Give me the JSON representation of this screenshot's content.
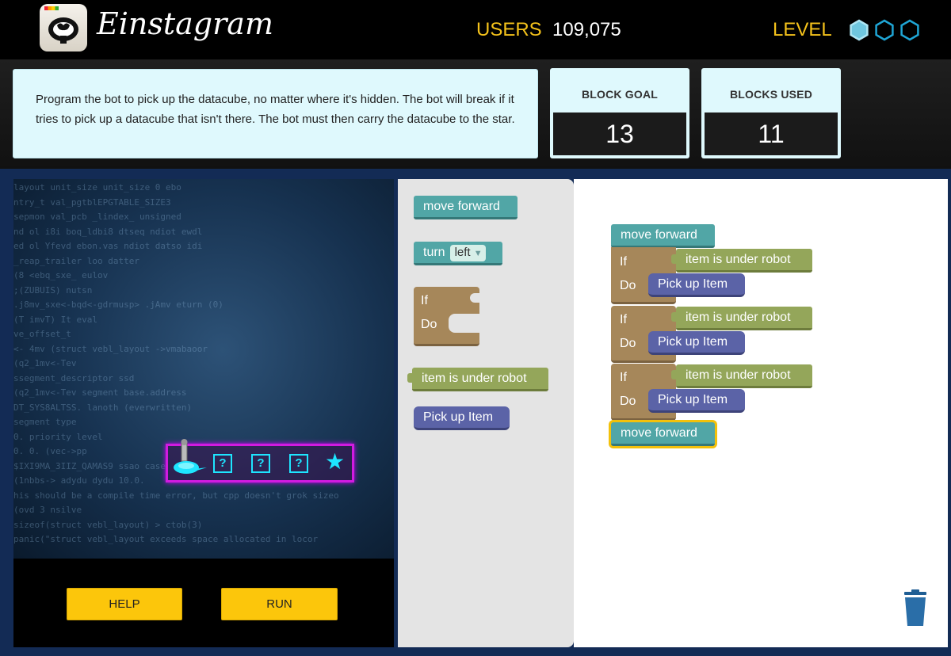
{
  "header": {
    "app_name": "Einstagram",
    "users_label": "USERS",
    "users_value": "109,075",
    "level_label": "LEVEL",
    "level_total": 3,
    "level_completed": 1
  },
  "instructions": {
    "text": "Program the bot to pick up the datacube, no matter where it's hidden. The bot will break if it tries to pick up a datacube that isn't there. The bot must then carry the datacube to the star."
  },
  "stats": {
    "block_goal_label": "BLOCK GOAL",
    "block_goal_value": "13",
    "blocks_used_label": "BLOCKS USED",
    "blocks_used_value": "11"
  },
  "game": {
    "track_cells": [
      "?",
      "?",
      "?"
    ],
    "goal_icon": "star-icon",
    "robot_icon": "robot-icon",
    "background_code": [
      "layout   unit_size   unit_size    0  ebo",
      "ntry_t        val_pgtblEPGTABLE_SIZE3",
      "sepmon val_pcb    _lindex_  unsigned",
      "nd  ol  i8i  boq_ldbi8   dtseq   ndiot   ewdl",
      "ed  ol  Yfevd  ebon.vas  ndiot  datso  idi",
      "         _reap_trailer  loo  datter",
      "         (8  <ebq_sxe_  eulov",
      "         ;(ZUBUIS)  nutsn",
      "      .j8mv_sxe<-bqd<-gdrmusp>  .jAmv     eturn  (0)",
      "                      (T  imvT)  It          eval",
      "                                          ve_offset_t",
      "     <- 4mv  (struct  vebl_layout  ->vmabaoor",
      "  (q2_1mv<-Tev",
      "         ssegment_descriptor  ssd  ",
      "         (q2_1mv<-Tev          segment  base.address",
      "   DT_SYS8ALTSS.               lanoth  (everwritten)",
      "                               segment  type",
      "    0.                         priority  level",
      "   0.  0.                               (vec->pp",
      "     $IXI9MA_3IIZ_QAMAS9  ssao   case",
      "  (1nbbs->  adydu  dydu  10.0.",
      "his  should  be  a  compile  time  error,  but  cpp  doesn't  grok  sizeo",
      "          (ovd  3  nsilve",
      "  sizeof(struct  vebl_layout)  >  ctob(3)",
      "     panic(\"struct  vebl_layout  exceeds  space  allocated  in  locor"
    ]
  },
  "controls": {
    "help_label": "HELP",
    "run_label": "RUN"
  },
  "toolbox": {
    "move_forward": "move forward",
    "turn": "turn",
    "turn_option": "left",
    "if": "If",
    "do": "Do",
    "condition": "item is under robot",
    "pick_up": "Pick up Item"
  },
  "workspace": {
    "first_block": "move forward",
    "if_blocks": [
      {
        "if": "If",
        "do": "Do",
        "condition": "item is under robot",
        "action": "Pick up Item"
      },
      {
        "if": "If",
        "do": "Do",
        "condition": "item is under robot",
        "action": "Pick up Item"
      },
      {
        "if": "If",
        "do": "Do",
        "condition": "item is under robot",
        "action": "Pick up Item"
      }
    ],
    "last_block": "move forward"
  },
  "colors": {
    "accent_yellow": "#f4c21b",
    "teal_block": "#51a6a6",
    "olive_block": "#94a65a",
    "purple_block": "#5b63a7",
    "tan_block": "#a6875a",
    "cyan": "#1ee5ff",
    "magenta": "#d11be0"
  }
}
